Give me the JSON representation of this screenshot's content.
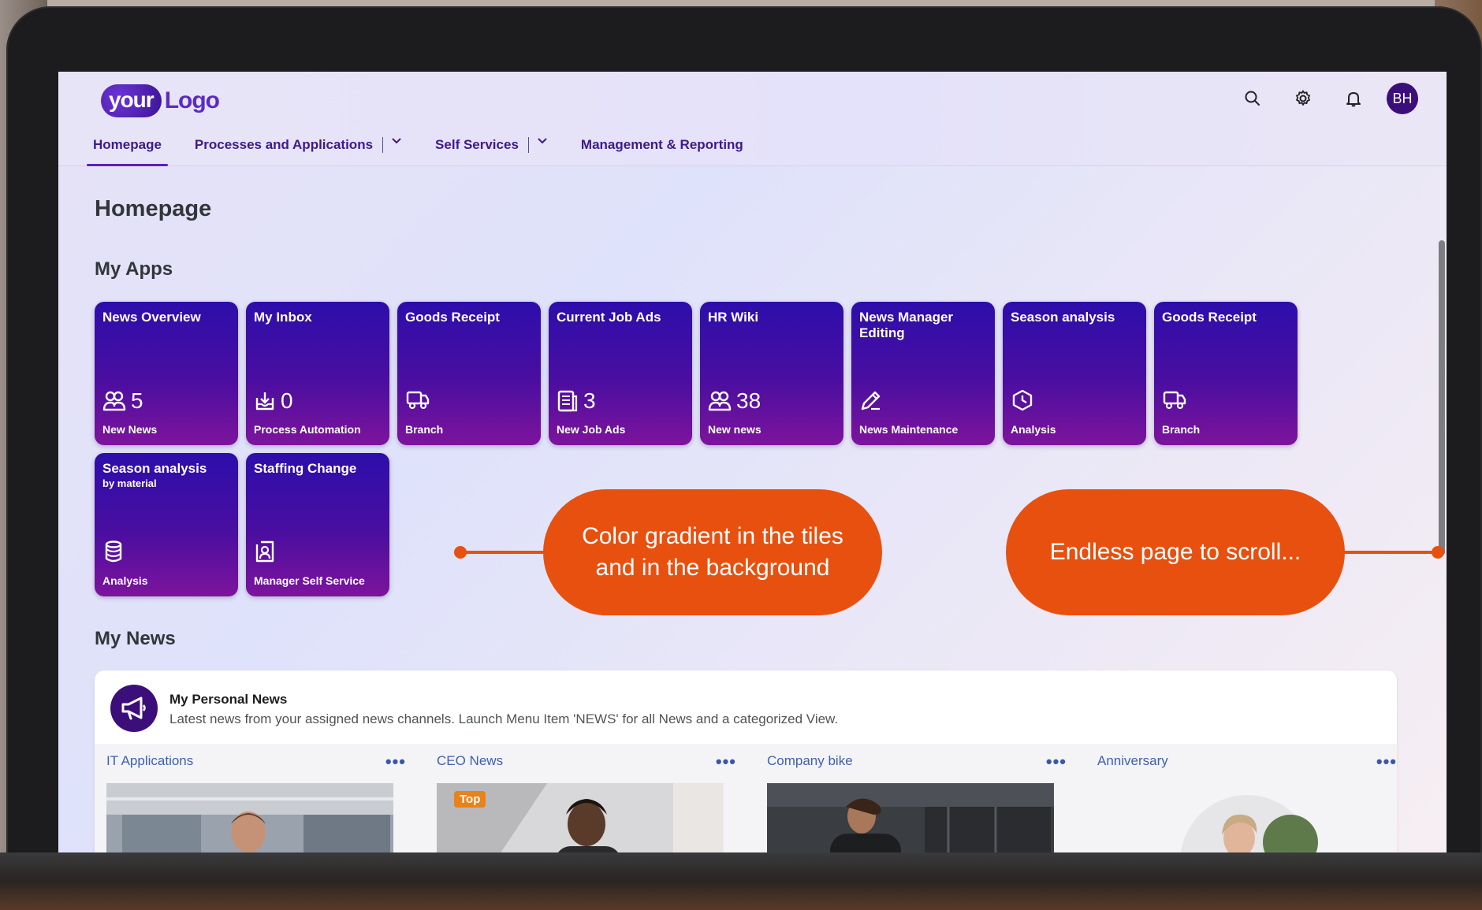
{
  "header": {
    "logo_your": "your",
    "logo_text": "Logo",
    "avatar_initials": "BH"
  },
  "nav": {
    "items": [
      {
        "label": "Homepage",
        "active": true,
        "dropdown": false
      },
      {
        "label": "Processes and Applications",
        "active": false,
        "dropdown": true
      },
      {
        "label": "Self Services",
        "active": false,
        "dropdown": true
      },
      {
        "label": "Management & Reporting",
        "active": false,
        "dropdown": false
      }
    ]
  },
  "page": {
    "title": "Homepage",
    "my_apps_title": "My Apps",
    "my_news_title": "My News"
  },
  "tiles": [
    {
      "title": "News Overview",
      "subtitle": "",
      "icon": "people-icon",
      "number": "5",
      "footer": "New News"
    },
    {
      "title": "My Inbox",
      "subtitle": "",
      "icon": "inbox-icon",
      "number": "0",
      "footer": "Process Automation"
    },
    {
      "title": "Goods Receipt",
      "subtitle": "",
      "icon": "truck-icon",
      "number": "",
      "footer": "Branch"
    },
    {
      "title": "Current Job Ads",
      "subtitle": "",
      "icon": "document-icon",
      "number": "3",
      "footer": "New Job Ads"
    },
    {
      "title": "HR Wiki",
      "subtitle": "",
      "icon": "people-icon",
      "number": "38",
      "footer": "New news"
    },
    {
      "title": "News Manager Editing",
      "subtitle": "",
      "icon": "edit-icon",
      "number": "",
      "footer": "News Maintenance"
    },
    {
      "title": "Season analysis",
      "subtitle": "",
      "icon": "analysis-icon",
      "number": "",
      "footer": "Analysis"
    },
    {
      "title": "Goods Receipt",
      "subtitle": "",
      "icon": "truck-icon",
      "number": "",
      "footer": "Branch"
    },
    {
      "title": "Season analysis",
      "subtitle": "by material",
      "icon": "database-icon",
      "number": "",
      "footer": "Analysis"
    },
    {
      "title": "Staffing Change",
      "subtitle": "",
      "icon": "manager-icon",
      "number": "",
      "footer": "Manager Self Service"
    }
  ],
  "callouts": {
    "gradient": "Color gradient in the tiles and in the background",
    "scroll": "Endless page to scroll..."
  },
  "news": {
    "title": "My Personal News",
    "description": "Latest news from your assigned news channels. Launch Menu Item 'NEWS' for all News and a categorized View.",
    "columns": [
      {
        "title": "IT Applications",
        "more": "•••",
        "badge": ""
      },
      {
        "title": "CEO News",
        "more": "•••",
        "badge": "Top"
      },
      {
        "title": "Company bike",
        "more": "•••",
        "badge": ""
      },
      {
        "title": "Anniversary",
        "more": "•••",
        "badge": ""
      }
    ]
  },
  "colors": {
    "accent": "#5b1fb8",
    "tile_top": "#2d0eab",
    "tile_bottom": "#7d149c",
    "callout": "#e8500f",
    "avatar": "#3b0e7a"
  }
}
